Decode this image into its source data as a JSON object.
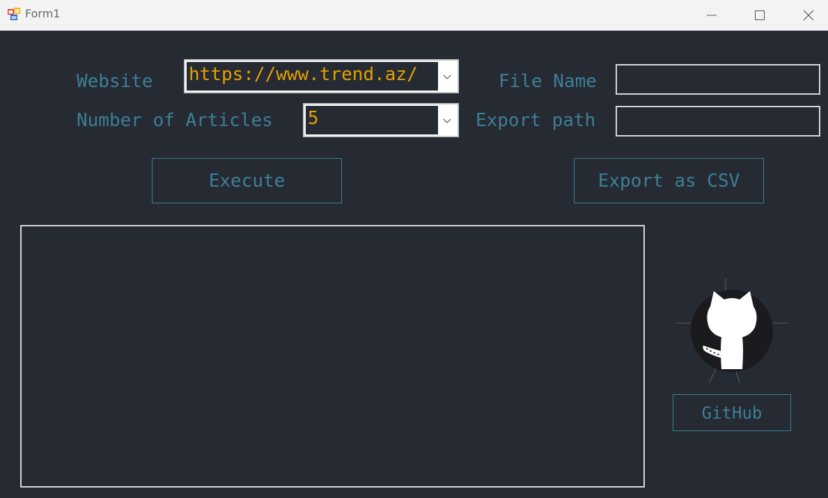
{
  "window": {
    "title": "Form1"
  },
  "labels": {
    "website": "Website",
    "articles": "Number of Articles",
    "file_name": "File Name",
    "export_path": "Export path"
  },
  "inputs": {
    "website_value": "https://www.trend.az/",
    "articles_value": "5",
    "file_name_value": "",
    "export_path_value": ""
  },
  "buttons": {
    "execute": "Execute",
    "export_csv": "Export as CSV",
    "github": "GitHub"
  },
  "output": {
    "text": ""
  },
  "icons": {
    "app": "form-app-icon",
    "minimize": "minimize-icon",
    "maximize": "maximize-icon",
    "close": "close-icon",
    "dropdown": "chevron-down-icon",
    "github": "github-octocat-icon"
  },
  "colors": {
    "background": "#262a33",
    "accent": "#3d7f95",
    "value_text": "#e5a100",
    "border": "#d8d8d8"
  }
}
